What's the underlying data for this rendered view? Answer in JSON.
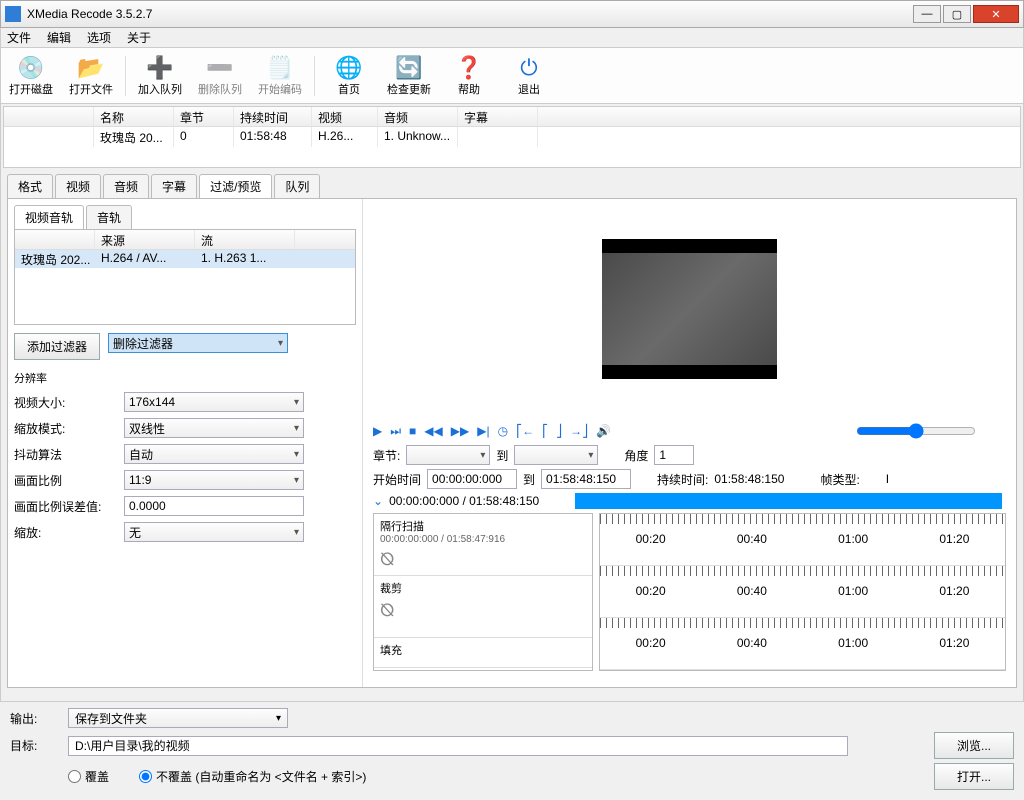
{
  "window": {
    "title": "XMedia Recode 3.5.2.7"
  },
  "menu": {
    "file": "文件",
    "edit": "编辑",
    "options": "选项",
    "about": "关于"
  },
  "toolbar": {
    "openDisc": "打开磁盘",
    "openFile": "打开文件",
    "addQueue": "加入队列",
    "removeQueue": "删除队列",
    "startEncode": "开始编码",
    "home": "首页",
    "checkUpdate": "检查更新",
    "help": "帮助",
    "exit": "退出"
  },
  "filelist": {
    "cols": {
      "name": "名称",
      "chapter": "章节",
      "duration": "持续时间",
      "video": "视频",
      "audio": "音频",
      "subtitle": "字幕"
    },
    "row": {
      "name": "玫瑰岛 20...",
      "chapter": "0",
      "duration": "01:58:48",
      "video": "H.26...",
      "audio": "1. Unknow...",
      "subtitle": ""
    }
  },
  "tabs": {
    "format": "格式",
    "video": "视频",
    "audio": "音频",
    "subtitle": "字幕",
    "filter": "过滤/预览",
    "queue": "队列"
  },
  "subtabs": {
    "vtrack": "视频音轨",
    "atrack": "音轨"
  },
  "tracklist": {
    "cols": {
      "src": "来源",
      "stream": "流"
    },
    "row": {
      "name": "玫瑰岛 202...",
      "src": "H.264 / AV...",
      "stream": "1. H.263 1..."
    }
  },
  "buttons": {
    "addFilter": "添加过滤器",
    "delFilter": "删除过滤器",
    "browse": "浏览...",
    "open": "打开..."
  },
  "group": {
    "title": "分辨率",
    "videoSize": "视频大小:",
    "videoSizeVal": "176x144",
    "scaleMode": "缩放模式:",
    "scaleModeVal": "双线性",
    "dither": "抖动算法",
    "ditherVal": "自动",
    "aspect": "画面比例",
    "aspectVal": "11:9",
    "aspectErr": "画面比例误差值:",
    "aspectErrVal": "0.0000",
    "scale": "缩放:",
    "scaleVal": "无"
  },
  "play": {
    "chapter": "章节:",
    "to": "到",
    "angle": "角度",
    "angleVal": "1",
    "start": "开始时间",
    "startVal": "00:00:00:000",
    "endVal": "01:58:48:150",
    "duration": "持续时间:",
    "durationVal": "01:58:48:150",
    "frameType": "帧类型:",
    "frameTypeVal": "I",
    "progress": "00:00:00:000 / 01:58:48:150"
  },
  "timeline": {
    "interlace": "隔行扫描",
    "interlaceSub": "00:00:00:000 / 01:58:47:916",
    "crop": "裁剪",
    "fill": "填充",
    "ticks": [
      "00:20",
      "00:40",
      "01:00",
      "01:20"
    ]
  },
  "output": {
    "label": "输出:",
    "mode": "保存到文件夹",
    "target": "目标:",
    "targetVal": "D:\\用户目录\\我的视频",
    "overwrite": "覆盖",
    "noOverwrite": "不覆盖 (自动重命名为 <文件名 + 索引>)"
  }
}
